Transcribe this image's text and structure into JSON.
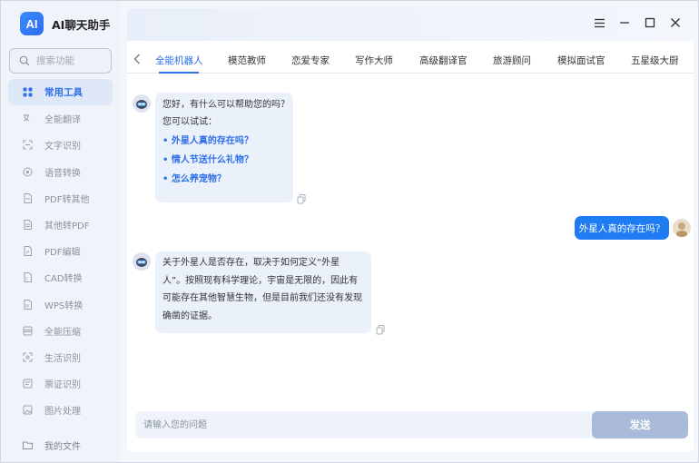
{
  "app": {
    "logo_text": "AI",
    "title": "AI聊天助手"
  },
  "colors": {
    "accent": "#2f6fe8",
    "user_bubble": "#1f7cf2",
    "send_disabled": "#a9bbd8"
  },
  "sidebar": {
    "search_placeholder": "搜索功能",
    "items": [
      {
        "label": "常用工具",
        "icon": "toolbox-icon",
        "active": true
      },
      {
        "label": "全能翻译",
        "icon": "translate-icon"
      },
      {
        "label": "文字识别",
        "icon": "scan-icon"
      },
      {
        "label": "语音转换",
        "icon": "audio-icon"
      },
      {
        "label": "PDF转其他",
        "icon": "pdf-icon"
      },
      {
        "label": "其他转PDF",
        "icon": "file-icon"
      },
      {
        "label": "PDF编辑",
        "icon": "edit-icon"
      },
      {
        "label": "CAD转换",
        "icon": "cad-icon"
      },
      {
        "label": "WPS转换",
        "icon": "wps-icon"
      },
      {
        "label": "全能压缩",
        "icon": "compress-icon"
      },
      {
        "label": "生活识别",
        "icon": "camera-icon"
      },
      {
        "label": "票证识别",
        "icon": "ticket-icon"
      },
      {
        "label": "图片处理",
        "icon": "image-icon"
      }
    ],
    "bottom_item": {
      "label": "我的文件",
      "icon": "folder-icon"
    }
  },
  "tabs": [
    {
      "label": "全能机器人",
      "active": true
    },
    {
      "label": "模范教师"
    },
    {
      "label": "恋爱专家"
    },
    {
      "label": "写作大师"
    },
    {
      "label": "高级翻译官"
    },
    {
      "label": "旅游顾问"
    },
    {
      "label": "模拟面试官"
    },
    {
      "label": "五星级大厨"
    }
  ],
  "chat": {
    "greeting": "您好，有什么可以帮助您的吗？",
    "try_text": "您可以试试：",
    "suggestions": [
      "外星人真的存在吗？",
      "情人节送什么礼物？",
      "怎么养宠物？"
    ],
    "user_message": "外星人真的存在吗？",
    "answer_lines": [
      "关于外星人是否存在，取决于如何定义“外星",
      "人”。按照现有科学理论，宇宙是无限的，因此有",
      "可能存在其他智慧生物，但是目前我们还没有发现",
      "确凿的证据。"
    ]
  },
  "input": {
    "placeholder": "请输入您的问题",
    "send_label": "发送"
  }
}
